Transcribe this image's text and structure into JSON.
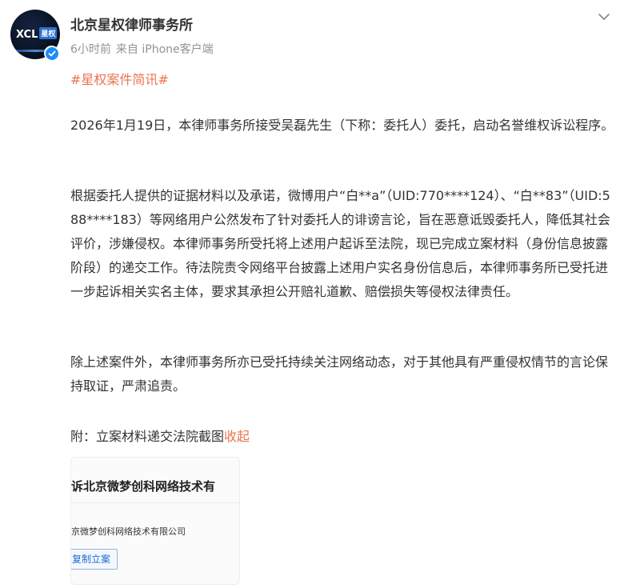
{
  "post": {
    "author": "北京星权律师事务所",
    "time": "6小时前",
    "source": "来自 iPhone客户端",
    "hashtag": "#星权案件简讯#",
    "paragraphs": [
      "2026年1月19日，本律师事务所接受吴磊先生（下称：委托人）委托，启动名誉维权诉讼程序。",
      "根据委托人提供的证据材料以及承诺，微博用户“白**a”（UID:770****124）、“白**83”（UID:588****183）等网络用户公然发布了针对委托人的诽谤言论，旨在恶意诋毁委托人，降低其社会评价，涉嫌侵权。本律师事务所受托将上述用户起诉至法院，现已完成立案材料（身份信息披露阶段）的递交工作。待法院责令网络平台披露上述用户实名身份信息后，本律师事务所已受托进一步起诉相关实名主体，要求其承担公开赔礼道歉、赔偿损失等侵权法律责任。",
      "除上述案件外，本律师事务所亦已受托持续关注网络动态，对于其他具有严重侵权情节的言论保持取证，严肃追责。"
    ],
    "attachment_label": "附：立案材料递交法院截图",
    "collapse_label": "收起",
    "avatar_text": "XCL 星权",
    "avatar_box": "星权"
  },
  "thumbnail": {
    "title_line": "诉北京微梦创科网络技术有",
    "company_line": "京微梦创科网络技术有限公司",
    "button_label": "复制立案"
  },
  "colors": {
    "accent": "#eb7350",
    "verified": "#1f8df5",
    "meta": "#939393"
  },
  "icons": [
    "verified-badge-icon",
    "chevron-down-icon"
  ]
}
